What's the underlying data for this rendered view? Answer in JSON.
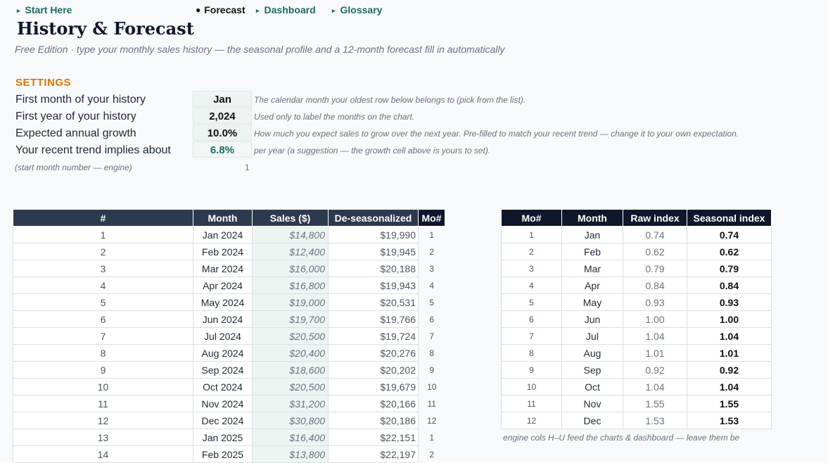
{
  "nav": {
    "start_here": "Start Here",
    "forecast": "Forecast",
    "dashboard": "Dashboard",
    "glossary": "Glossary"
  },
  "header": {
    "title": "History & Forecast",
    "subtitle": "Free Edition · type your monthly sales history — the seasonal profile and a 12-month forecast fill in automatically"
  },
  "settings": {
    "heading": "SETTINGS",
    "rows": [
      {
        "label": "First month of your history",
        "value": "Jan",
        "note": "The calendar month your oldest row below belongs to (pick from the list)."
      },
      {
        "label": "First year of your history",
        "value": "2,024",
        "note": "Used only to label the months on the chart."
      },
      {
        "label": "Expected annual growth",
        "value": "10.0%",
        "note": "How much you expect sales to grow over the next year. Pre-filled to match your recent trend — change it to your own expectation."
      },
      {
        "label": "Your recent trend implies about",
        "value": "6.8%",
        "note": "per year (a suggestion — the growth cell above is yours to set)."
      }
    ],
    "engine_note": "(start month number — engine)",
    "engine_value": "1"
  },
  "history": {
    "headers": [
      "#",
      "Month",
      "Sales ($)",
      "De-seasonalized",
      "Mo#"
    ],
    "rows": [
      {
        "n": "1",
        "month": "Jan 2024",
        "sales": "$14,800",
        "deseas": "$19,990",
        "mo": "1"
      },
      {
        "n": "2",
        "month": "Feb 2024",
        "sales": "$12,400",
        "deseas": "$19,945",
        "mo": "2"
      },
      {
        "n": "3",
        "month": "Mar 2024",
        "sales": "$16,000",
        "deseas": "$20,188",
        "mo": "3"
      },
      {
        "n": "4",
        "month": "Apr 2024",
        "sales": "$16,800",
        "deseas": "$19,943",
        "mo": "4"
      },
      {
        "n": "5",
        "month": "May 2024",
        "sales": "$19,000",
        "deseas": "$20,531",
        "mo": "5"
      },
      {
        "n": "6",
        "month": "Jun 2024",
        "sales": "$19,700",
        "deseas": "$19,766",
        "mo": "6"
      },
      {
        "n": "7",
        "month": "Jul 2024",
        "sales": "$20,500",
        "deseas": "$19,724",
        "mo": "7"
      },
      {
        "n": "8",
        "month": "Aug 2024",
        "sales": "$20,400",
        "deseas": "$20,276",
        "mo": "8"
      },
      {
        "n": "9",
        "month": "Sep 2024",
        "sales": "$18,600",
        "deseas": "$20,202",
        "mo": "9"
      },
      {
        "n": "10",
        "month": "Oct 2024",
        "sales": "$20,500",
        "deseas": "$19,679",
        "mo": "10"
      },
      {
        "n": "11",
        "month": "Nov 2024",
        "sales": "$31,200",
        "deseas": "$20,166",
        "mo": "11"
      },
      {
        "n": "12",
        "month": "Dec 2024",
        "sales": "$30,800",
        "deseas": "$20,186",
        "mo": "12"
      },
      {
        "n": "13",
        "month": "Jan 2025",
        "sales": "$16,400",
        "deseas": "$22,151",
        "mo": "1"
      },
      {
        "n": "14",
        "month": "Feb 2025",
        "sales": "$13,800",
        "deseas": "$22,197",
        "mo": "2"
      }
    ]
  },
  "seasonal": {
    "headers": [
      "Mo#",
      "Month",
      "Raw index",
      "Seasonal index"
    ],
    "rows": [
      {
        "mo": "1",
        "month": "Jan",
        "raw": "0.74",
        "idx": "0.74"
      },
      {
        "mo": "2",
        "month": "Feb",
        "raw": "0.62",
        "idx": "0.62"
      },
      {
        "mo": "3",
        "month": "Mar",
        "raw": "0.79",
        "idx": "0.79"
      },
      {
        "mo": "4",
        "month": "Apr",
        "raw": "0.84",
        "idx": "0.84"
      },
      {
        "mo": "5",
        "month": "May",
        "raw": "0.93",
        "idx": "0.93"
      },
      {
        "mo": "6",
        "month": "Jun",
        "raw": "1.00",
        "idx": "1.00"
      },
      {
        "mo": "7",
        "month": "Jul",
        "raw": "1.04",
        "idx": "1.04"
      },
      {
        "mo": "8",
        "month": "Aug",
        "raw": "1.01",
        "idx": "1.01"
      },
      {
        "mo": "9",
        "month": "Sep",
        "raw": "0.92",
        "idx": "0.92"
      },
      {
        "mo": "10",
        "month": "Oct",
        "raw": "1.04",
        "idx": "1.04"
      },
      {
        "mo": "11",
        "month": "Nov",
        "raw": "1.55",
        "idx": "1.55"
      },
      {
        "mo": "12",
        "month": "Dec",
        "raw": "1.53",
        "idx": "1.53"
      }
    ],
    "note": "engine cols H–U feed the charts & dashboard — leave them be"
  }
}
